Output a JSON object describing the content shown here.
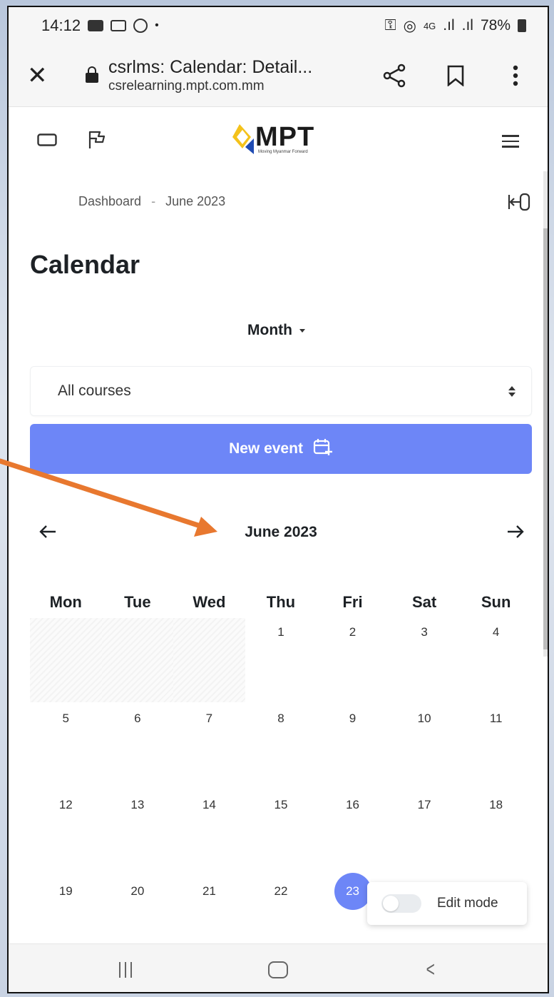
{
  "status_bar": {
    "time": "14:12",
    "battery": "78%",
    "network": "4G"
  },
  "browser": {
    "page_title": "csrlms: Calendar: Detail...",
    "url": "csrelearning.mpt.com.mm"
  },
  "logo": {
    "text": "MPT",
    "tagline": "Moving Myanmar Forward"
  },
  "breadcrumb": {
    "items": [
      "Dashboard",
      "June 2023"
    ],
    "separator": "-"
  },
  "page": {
    "title": "Calendar"
  },
  "view_select": {
    "label": "Month"
  },
  "course_select": {
    "value": "All courses"
  },
  "new_event_button": {
    "label": "New event"
  },
  "month_nav": {
    "current": "June 2023"
  },
  "calendar": {
    "weekdays": [
      "Mon",
      "Tue",
      "Wed",
      "Thu",
      "Fri",
      "Sat",
      "Sun"
    ],
    "weeks": [
      [
        "",
        "",
        "",
        "1",
        "2",
        "3",
        "4"
      ],
      [
        "5",
        "6",
        "7",
        "8",
        "9",
        "10",
        "11"
      ],
      [
        "12",
        "13",
        "14",
        "15",
        "16",
        "17",
        "18"
      ],
      [
        "19",
        "20",
        "21",
        "22",
        "23",
        "",
        ""
      ]
    ],
    "today": "23"
  },
  "edit_mode": {
    "label": "Edit mode",
    "enabled": false
  },
  "colors": {
    "primary": "#6d86f7",
    "annotation_arrow": "#e8782f",
    "text_dark": "#1d2125"
  },
  "icons": {
    "close": "close-icon",
    "lock": "lock-icon",
    "share": "share-icon",
    "bookmark": "bookmark-icon",
    "more": "more-vert-icon",
    "drawer": "drawer-toggle-icon",
    "flag": "flag-icon",
    "menu": "hamburger-menu-icon",
    "exit": "exit-icon",
    "calendar_add": "calendar-plus-icon",
    "prev": "arrow-left-icon",
    "next": "arrow-right-icon"
  }
}
